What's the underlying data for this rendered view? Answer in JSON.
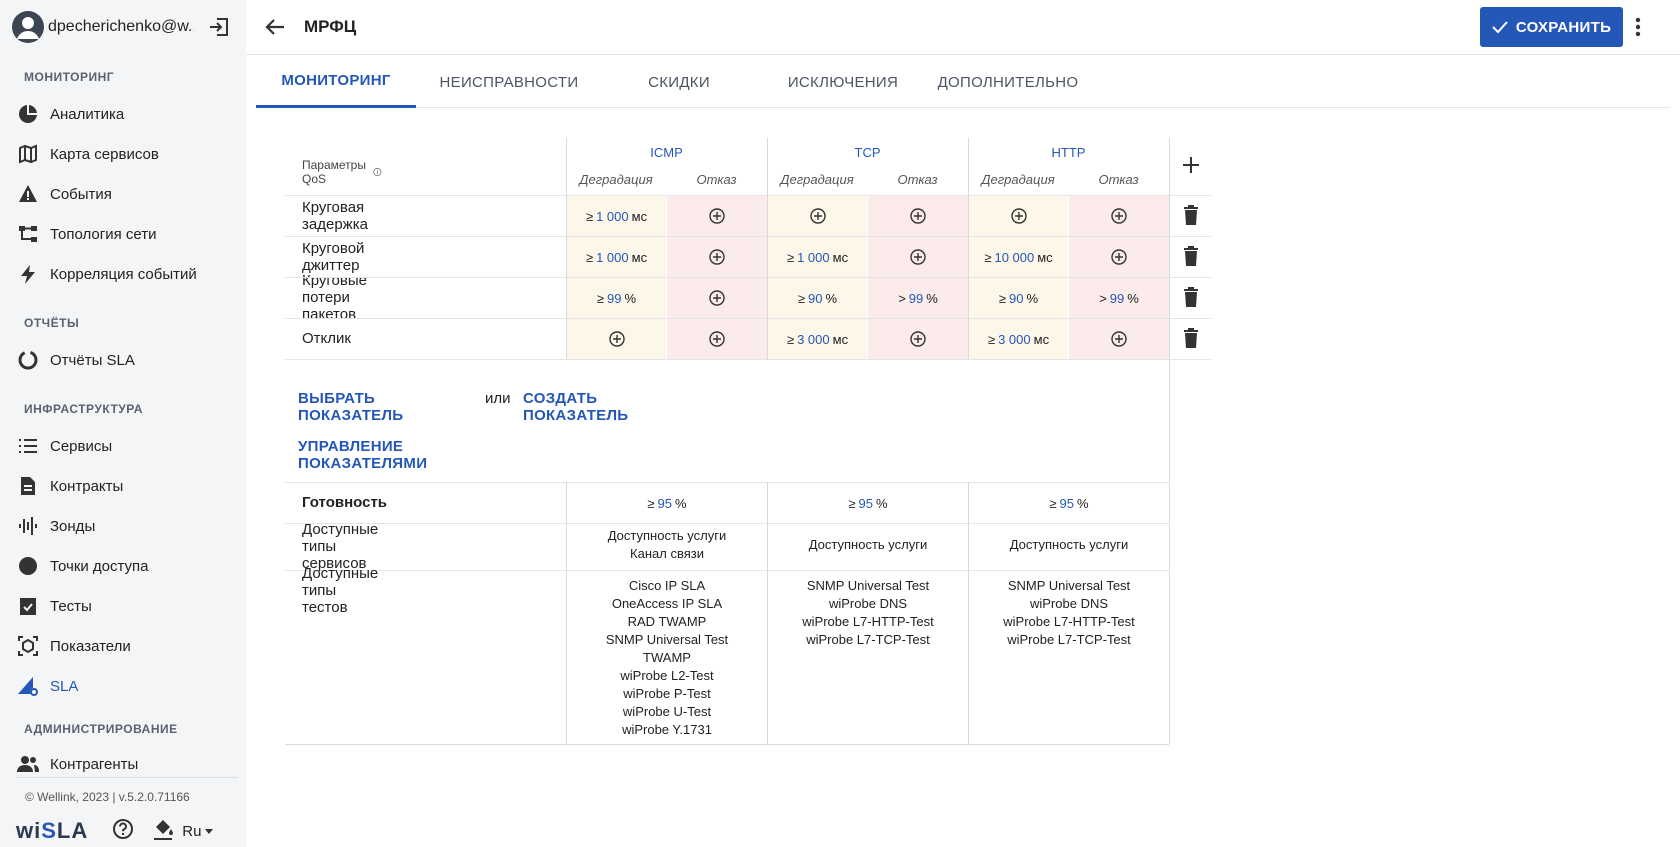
{
  "sidebar": {
    "user_email": "dpecherichenko@w...",
    "sections": [
      "МОНИТОРИНГ",
      "ОТЧЁТЫ",
      "ИНФРАСТРУКТУРА",
      "АДМИНИСТРИРОВАНИЕ"
    ],
    "items": [
      {
        "label": "Аналитика",
        "icon": "pie-chart-icon"
      },
      {
        "label": "Карта сервисов",
        "icon": "map-icon"
      },
      {
        "label": "События",
        "icon": "warning-icon"
      },
      {
        "label": "Топология сети",
        "icon": "topology-icon"
      },
      {
        "label": "Корреляция событий",
        "icon": "bolt-icon"
      },
      {
        "label": "Отчёты SLA",
        "icon": "report-icon"
      },
      {
        "label": "Сервисы",
        "icon": "list-icon"
      },
      {
        "label": "Контракты",
        "icon": "document-icon"
      },
      {
        "label": "Зонды",
        "icon": "probe-icon"
      },
      {
        "label": "Точки доступа",
        "icon": "circle-icon"
      },
      {
        "label": "Тесты",
        "icon": "checklist-icon"
      },
      {
        "label": "Показатели",
        "icon": "metrics-icon"
      },
      {
        "label": "SLA",
        "icon": "sla-icon"
      },
      {
        "label": "Контрагенты",
        "icon": "people-icon"
      }
    ],
    "copyright": "© Wellink, 2023 | v.5.2.0.71166",
    "logo": {
      "pre": "wi",
      "acc": "S",
      "post": "LA"
    },
    "language": "Ru"
  },
  "header": {
    "title": "МРФЦ",
    "save_label": "СОХРАНИТЬ"
  },
  "tabs": [
    "МОНИТОРИНГ",
    "НЕИСПРАВНОСТИ",
    "СКИДКИ",
    "ИСКЛЮЧЕНИЯ",
    "ДОПОЛНИТЕЛЬНО"
  ],
  "qos": {
    "params_label": "Параметры QoS",
    "groups": [
      "ICMP",
      "TCP",
      "HTTP"
    ],
    "sub_degr": "Деградация",
    "sub_fail": "Отказ",
    "rows": [
      {
        "label": "Круговая задержка",
        "cells": [
          [
            "≥",
            "1 000",
            "мс"
          ],
          null,
          null,
          null,
          null,
          null
        ]
      },
      {
        "label": "Круговой джиттер",
        "cells": [
          [
            "≥",
            "1 000",
            "мс"
          ],
          null,
          [
            "≥",
            "1 000",
            "мс"
          ],
          null,
          [
            "≥",
            "10 000",
            "мс"
          ],
          null
        ]
      },
      {
        "label": "Круговые потери пакетов",
        "cells": [
          [
            "≥",
            "99",
            "%"
          ],
          null,
          [
            "≥",
            "90",
            "%"
          ],
          [
            ">",
            "99",
            "%"
          ],
          [
            "≥",
            "90",
            "%"
          ],
          [
            ">",
            "99",
            "%"
          ]
        ]
      },
      {
        "label": "Отклик",
        "cells": [
          null,
          null,
          [
            "≥",
            "3 000",
            "мс"
          ],
          null,
          [
            "≥",
            "3 000",
            "мс"
          ],
          null
        ]
      }
    ],
    "select_metric": "ВЫБРАТЬ ПОКАЗАТЕЛЬ",
    "or": "или",
    "create_metric": "СОЗДАТЬ ПОКАЗАТЕЛЬ",
    "manage_metrics": "УПРАВЛЕНИЕ ПОКАЗАТЕЛЯМИ",
    "availability": {
      "label": "Готовность",
      "values": [
        [
          "≥",
          "95",
          "%"
        ],
        [
          "≥",
          "95",
          "%"
        ],
        [
          "≥",
          "95",
          "%"
        ]
      ]
    },
    "service_types": {
      "label": "Доступные типы сервисов",
      "values": [
        [
          "Доступность услуги",
          "Канал связи"
        ],
        [
          "Доступность услуги"
        ],
        [
          "Доступность услуги"
        ]
      ]
    },
    "test_types": {
      "label": "Доступные типы тестов",
      "values": [
        [
          "Cisco IP SLA",
          "OneAccess IP SLA",
          "RAD TWAMP",
          "SNMP Universal Test",
          "TWAMP",
          "wiProbe L2-Test",
          "wiProbe P-Test",
          "wiProbe U-Test",
          "wiProbe Y.1731"
        ],
        [
          "SNMP Universal Test",
          "wiProbe DNS",
          "wiProbe L7-HTTP-Test",
          "wiProbe L7-TCP-Test"
        ],
        [
          "SNMP Universal Test",
          "wiProbe DNS",
          "wiProbe L7-HTTP-Test",
          "wiProbe L7-TCP-Test"
        ]
      ]
    }
  }
}
